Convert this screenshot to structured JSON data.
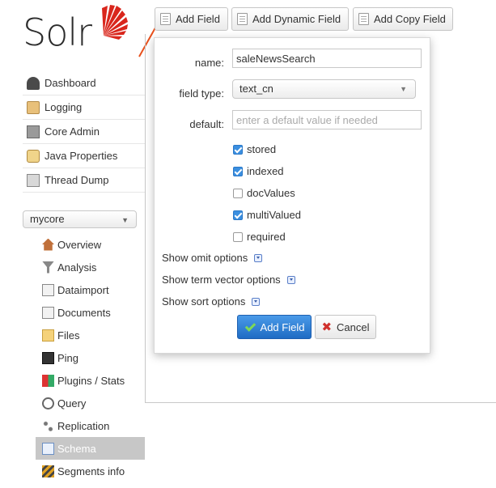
{
  "logo": {
    "text": "Solr"
  },
  "sidebar": {
    "items": [
      {
        "label": "Dashboard",
        "icon": "dashboard-icon"
      },
      {
        "label": "Logging",
        "icon": "logging-icon"
      },
      {
        "label": "Core Admin",
        "icon": "core-admin-icon"
      },
      {
        "label": "Java Properties",
        "icon": "java-properties-icon"
      },
      {
        "label": "Thread Dump",
        "icon": "thread-dump-icon"
      }
    ],
    "core_selector": {
      "value": "mycore"
    },
    "core_items": [
      {
        "label": "Overview",
        "icon": "home-icon"
      },
      {
        "label": "Analysis",
        "icon": "funnel-icon"
      },
      {
        "label": "Dataimport",
        "icon": "dataimport-icon"
      },
      {
        "label": "Documents",
        "icon": "documents-icon"
      },
      {
        "label": "Files",
        "icon": "folder-icon"
      },
      {
        "label": "Ping",
        "icon": "ping-icon"
      },
      {
        "label": "Plugins / Stats",
        "icon": "plugins-icon"
      },
      {
        "label": "Query",
        "icon": "magnifier-icon"
      },
      {
        "label": "Replication",
        "icon": "replication-icon"
      },
      {
        "label": "Schema",
        "icon": "schema-icon",
        "active": true
      },
      {
        "label": "Segments info",
        "icon": "segments-icon"
      }
    ]
  },
  "toolbar": {
    "add_field": "Add Field",
    "add_dynamic_field": "Add Dynamic Field",
    "add_copy_field": "Add Copy Field"
  },
  "dialog": {
    "name_label": "name:",
    "name_value": "saleNewsSearch",
    "field_type_label": "field type:",
    "field_type_value": "text_cn",
    "default_label": "default:",
    "default_placeholder": "enter a default value if needed",
    "checkboxes": [
      {
        "label": "stored",
        "checked": true
      },
      {
        "label": "indexed",
        "checked": true
      },
      {
        "label": "docValues",
        "checked": false
      },
      {
        "label": "multiValued",
        "checked": true
      },
      {
        "label": "required",
        "checked": false
      }
    ],
    "options": {
      "omit": "Show omit options",
      "term_vector": "Show term vector options",
      "sort": "Show sort options"
    },
    "submit_label": "Add Field",
    "cancel_label": "Cancel"
  },
  "colors": {
    "primary_button": "#2a7fd4",
    "checkbox_checked": "#3b8fe0",
    "logo_accent": "#d9261c",
    "cancel_x": "#d0312d"
  }
}
